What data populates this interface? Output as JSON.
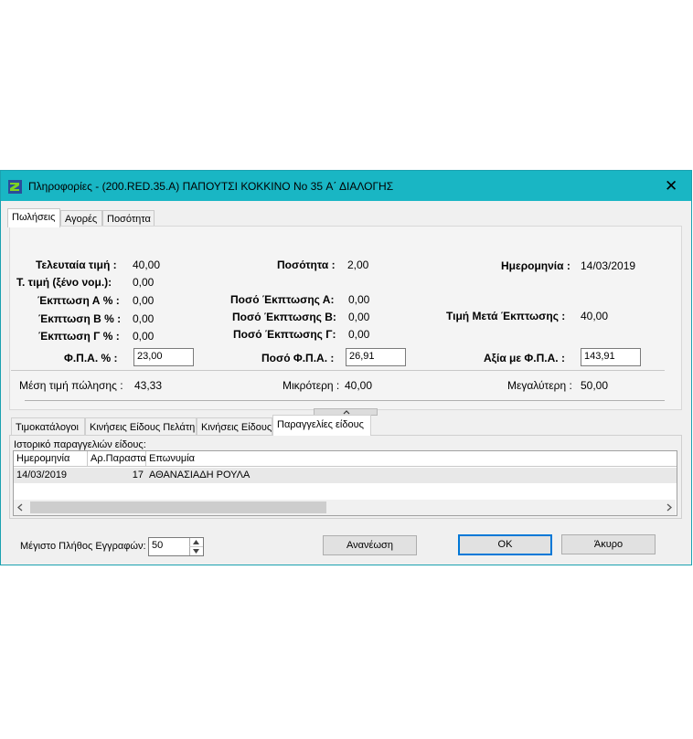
{
  "window": {
    "title": "Πληροφορίες - (200.RED.35.A) ΠΑΠΟΥΤΣΙ  ΚΟΚΚΙΝΟ No 35 Α΄ ΔΙΑΛΟΓΗΣ",
    "close_glyph": "✕"
  },
  "tabs": [
    "Πωλήσεις",
    "Αγορές",
    "Ποσότητα"
  ],
  "sales": {
    "last_price_label": "Τελευταία τιμή :",
    "last_price": "40,00",
    "quantity_label": "Ποσότητα :",
    "quantity": "2,00",
    "date_label": "Ημερομηνία :",
    "date": "14/03/2019",
    "foreign_price_label": "Τ. τιμή (ξένο νομ.):",
    "foreign_price": "0,00",
    "disc_a_label": "Έκπτωση Α % :",
    "disc_a": "0,00",
    "disc_b_label": "Έκπτωση Β % :",
    "disc_b": "0,00",
    "disc_c_label": "Έκπτωση Γ % :",
    "disc_c": "0,00",
    "amt_disc_a_label": "Ποσό Έκπτωσης Α:",
    "amt_disc_a": "0,00",
    "amt_disc_b_label": "Ποσό Έκπτωσης Β:",
    "amt_disc_b": "0,00",
    "amt_disc_c_label": "Ποσό Έκπτωσης Γ:",
    "amt_disc_c": "0,00",
    "price_after_label": "Τιμή Μετά Έκπτωσης :",
    "price_after": "40,00",
    "vat_pct_label": "Φ.Π.Α. % :",
    "vat_pct": "23,00",
    "vat_amt_label": "Ποσό Φ.Π.Α. :",
    "vat_amt": "26,91",
    "value_vat_label": "Αξία με Φ.Π.Α. :",
    "value_vat": "143,91",
    "avg_label": "Μέση τιμή πώλησης :",
    "avg": "43,33",
    "min_label": "Μικρότερη :",
    "min": "40,00",
    "max_label": "Μεγαλύτερη :",
    "max": "50,00"
  },
  "subtabs": [
    "Τιμοκατάλογοι",
    "Κινήσεις Είδους Πελάτη",
    "Κινήσεις Είδους",
    "Παραγγελίες είδους"
  ],
  "orders": {
    "caption": "Ιστορικό παραγγελιών είδους:",
    "columns": [
      "Ημερομηνία",
      "Αρ.Παραστατ",
      "Επωνυμία"
    ],
    "rows": [
      [
        "14/03/2019",
        "17",
        "ΑΘΑΝΑΣΙΑΔΗ ΡΟΥΛΑ"
      ]
    ]
  },
  "footer": {
    "max_records_label": "Μέγιστο Πλήθος Εγγραφών:",
    "max_records": "50",
    "refresh": "Ανανέωση",
    "ok": "OK",
    "cancel": "Άκυρο"
  },
  "colors": {
    "titlebar": "#19b6c4",
    "default_button_border": "#0078d7"
  }
}
